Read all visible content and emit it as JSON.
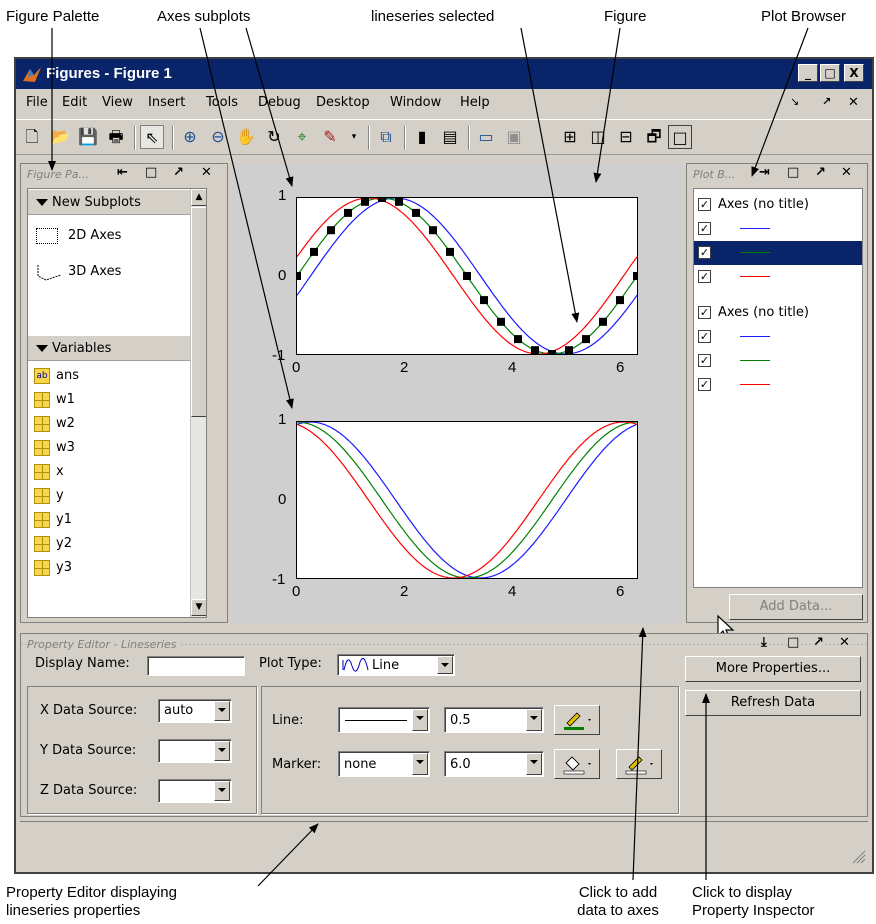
{
  "callouts": {
    "figure_palette": "Figure Palette",
    "axes_subplots": "Axes subplots",
    "lineseries_selected": "lineseries selected",
    "figure": "Figure",
    "plot_browser": "Plot Browser",
    "property_editor_line1": "Property Editor displaying",
    "property_editor_line2": "lineseries properties",
    "add_data_line1": "Click to add",
    "add_data_line2": "data to axes",
    "prop_inspector_line1": "Click to display",
    "prop_inspector_line2": "Property Inspector"
  },
  "window": {
    "title": "Figures - Figure 1",
    "controls": {
      "minimize": "_",
      "maximize": "□",
      "close": "X"
    }
  },
  "menu": [
    "File",
    "Edit",
    "View",
    "Insert",
    "Tools",
    "Debug",
    "Desktop",
    "Window",
    "Help"
  ],
  "figure_palette": {
    "title": "Figure Pa...",
    "new_subplots": "New Subplots",
    "axes_2d": "2D Axes",
    "axes_3d": "3D Axes",
    "variables_header": "Variables",
    "variables": [
      "ans",
      "w1",
      "w2",
      "w3",
      "x",
      "y",
      "y1",
      "y2",
      "y3"
    ]
  },
  "plot_browser": {
    "title": "Plot B...",
    "groups": [
      {
        "label": "Axes (no title)",
        "series_colors": [
          "#1a1aff",
          "#008000",
          "#ff0000"
        ]
      },
      {
        "label": "Axes (no title)",
        "series_colors": [
          "#1a1aff",
          "#008000",
          "#ff0000"
        ]
      }
    ],
    "selected_index": 1,
    "add_data_button": "Add Data..."
  },
  "axes_top": {
    "x_ticks": [
      "0",
      "2",
      "4",
      "6"
    ],
    "y_ticks": [
      "1",
      "0",
      "-1"
    ]
  },
  "axes_bottom": {
    "x_ticks": [
      "0",
      "2",
      "4",
      "6"
    ],
    "y_ticks": [
      "1",
      "0",
      "-1"
    ]
  },
  "property_editor": {
    "title": "Property Editor - Lineseries",
    "display_name_label": "Display Name:",
    "display_name_value": "",
    "plot_type_label": "Plot Type:",
    "plot_type_value": "Line",
    "x_source_label": "X Data Source:",
    "x_source_value": "auto",
    "y_source_label": "Y Data Source:",
    "y_source_value": "",
    "z_source_label": "Z Data Source:",
    "z_source_value": "",
    "line_label": "Line:",
    "line_width": "0.5",
    "marker_label": "Marker:",
    "marker_value": "none",
    "marker_size": "6.0",
    "more_properties_button": "More Properties...",
    "refresh_data_button": "Refresh Data"
  },
  "colors": {
    "title_bar": "#0a246a",
    "selection": "#0a246a",
    "series_blue": "#1a1aff",
    "series_green": "#008000",
    "series_red": "#ff0000"
  }
}
